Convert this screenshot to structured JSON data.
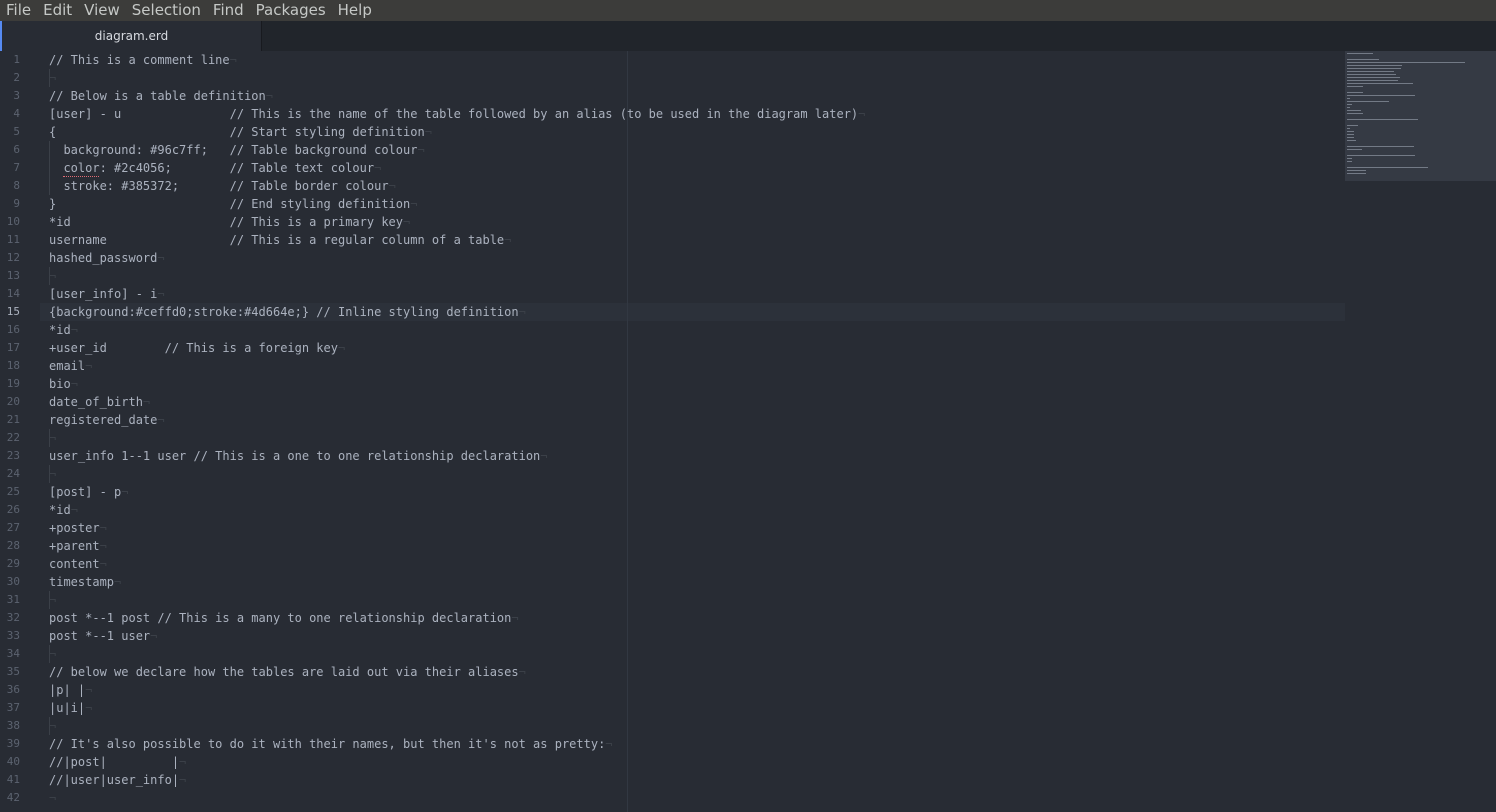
{
  "menu": [
    "File",
    "Edit",
    "View",
    "Selection",
    "Find",
    "Packages",
    "Help"
  ],
  "tab": {
    "title": "diagram.erd"
  },
  "editor": {
    "active_line": 15,
    "lines": [
      "// This is a comment line",
      "",
      "// Below is a table definition",
      "[user] - u               // This is the name of the table followed by an alias (to be used in the diagram later)",
      "{                        // Start styling definition",
      "  background: #96c7ff;   // Table background colour",
      "  color: #2c4056;        // Table text colour",
      "  stroke: #385372;       // Table border colour",
      "}                        // End styling definition",
      "*id                      // This is a primary key",
      "username                 // This is a regular column of a table",
      "hashed_password",
      "",
      "[user_info] - i",
      "{background:#ceffd0;stroke:#4d664e;} // Inline styling definition",
      "*id",
      "+user_id        // This is a foreign key",
      "email",
      "bio",
      "date_of_birth",
      "registered_date",
      "",
      "user_info 1--1 user // This is a one to one relationship declaration",
      "",
      "[post] - p",
      "*id",
      "+poster",
      "+parent",
      "content",
      "timestamp",
      "",
      "post *--1 post // This is a many to one relationship declaration",
      "post *--1 user",
      "",
      "// below we declare how the tables are laid out via their aliases",
      "|p| |",
      "|u|i|",
      "",
      "// It's also possible to do it with their names, but then it's not as pretty:",
      "//|post|         |",
      "//|user|user_info|",
      ""
    ]
  },
  "colors": {
    "background": "#282c34",
    "menubar": "#3c3c3a",
    "tab_accent": "#568af2",
    "text": "#abb2bf",
    "line_number": "#5c6370",
    "invisible": "#3b4048"
  }
}
